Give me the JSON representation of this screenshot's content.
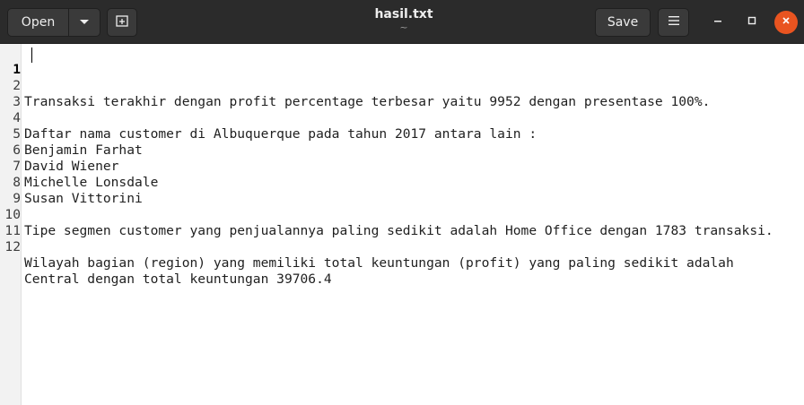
{
  "header": {
    "open_label": "Open",
    "save_label": "Save",
    "title": "hasil.txt",
    "subtitle": "~"
  },
  "colors": {
    "headerbar": "#2b2b2b",
    "button": "#3a3a3a",
    "close_accent": "#e95420",
    "gutter": "#f2f2f2"
  },
  "icons": {
    "open_menu": "chevron-down-icon",
    "new_tab": "new-tab-icon",
    "menu": "hamburger-menu-icon",
    "minimize": "minimize-icon",
    "maximize": "maximize-icon",
    "close": "close-icon"
  },
  "editor": {
    "lines": [
      {
        "num": "1",
        "text": ""
      },
      {
        "num": "2",
        "text": "Transaksi terakhir dengan profit percentage terbesar yaitu 9952 dengan presentase 100%."
      },
      {
        "num": "3",
        "text": ""
      },
      {
        "num": "4",
        "text": "Daftar nama customer di Albuquerque pada tahun 2017 antara lain :"
      },
      {
        "num": "5",
        "text": "Benjamin Farhat"
      },
      {
        "num": "6",
        "text": "David Wiener"
      },
      {
        "num": "7",
        "text": "Michelle Lonsdale"
      },
      {
        "num": "8",
        "text": "Susan Vittorini"
      },
      {
        "num": "9",
        "text": ""
      },
      {
        "num": "10",
        "text": "Tipe segmen customer yang penjualannya paling sedikit adalah Home Office dengan 1783 transaksi."
      },
      {
        "num": "11",
        "text": ""
      },
      {
        "num": "12",
        "text": "Wilayah bagian (region) yang memiliki total keuntungan (profit) yang paling sedikit adalah"
      },
      {
        "num": "",
        "text": "Central dengan total keuntungan 39706.4"
      }
    ]
  }
}
